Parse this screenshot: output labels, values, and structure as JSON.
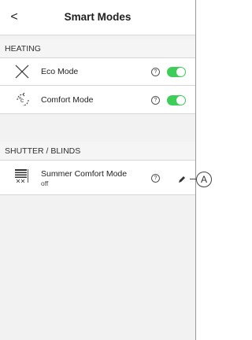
{
  "header": {
    "back_icon": "chevron-left-icon",
    "back_glyph": "<",
    "title": "Smart Modes"
  },
  "sections": [
    {
      "label": "HEATING",
      "items": [
        {
          "label": "Eco Mode",
          "icon": "eco-x-icon",
          "help_glyph": "?",
          "toggle_on": true
        },
        {
          "label": "Comfort Mode",
          "icon": "comfort-thermometer-icon",
          "help_glyph": "?",
          "toggle_on": true
        }
      ]
    },
    {
      "label": "SHUTTER / BLINDS",
      "items": [
        {
          "label": "Summer Comfort Mode",
          "sublabel": "off",
          "icon": "shutter-blinds-icon",
          "help_glyph": "?",
          "edit_icon": "pencil-icon"
        }
      ]
    }
  ],
  "callout": {
    "label": "A"
  },
  "colors": {
    "toggle_on": "#3dcd58",
    "background": "#f2f2f2",
    "divider": "#d6d6d6"
  }
}
